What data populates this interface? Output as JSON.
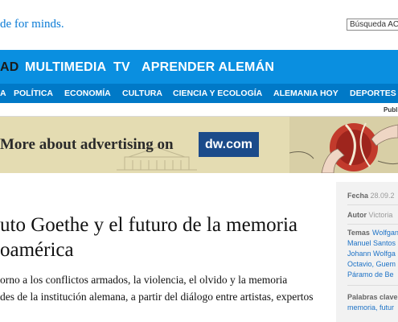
{
  "header": {
    "tagline": "de for minds.",
    "search_value": "Búsqueda ACT"
  },
  "main_nav": {
    "items": [
      {
        "label": "AD",
        "active": true
      },
      {
        "label": "MULTIMEDIA"
      },
      {
        "label": "TV"
      },
      {
        "label": "APRENDER ALEMÁN"
      }
    ]
  },
  "sub_nav": {
    "items": [
      {
        "label": "A"
      },
      {
        "label": "POLÍTICA"
      },
      {
        "label": "ECONOMÍA"
      },
      {
        "label": "CULTURA"
      },
      {
        "label": "CIENCIA Y ECOLOGÍA"
      },
      {
        "label": "ALEMANIA HOY"
      },
      {
        "label": "DEPORTES"
      }
    ]
  },
  "utility": {
    "label": "Publi"
  },
  "banner": {
    "text": "More about advertising on",
    "domain": "dw.com"
  },
  "article": {
    "headline_line1": "uto Goethe y el futuro de la memoria",
    "headline_line2": "oamérica",
    "lead_line1": "orno a los conflictos armados, la violencia, el olvido y la memoria",
    "lead_line2": "des de la institución alemana, a partir del diálogo entre artistas, expertos"
  },
  "meta": {
    "date_label": "Fecha",
    "date_value": "28.09.2",
    "author_label": "Autor",
    "author_value": "Victoria",
    "topics_label": "Temas",
    "topics": [
      "Wolfgan",
      "Manuel Santos",
      "Johann Wolfga",
      "Octavio, Guem",
      "Páramo de Be"
    ],
    "keywords_label": "Palabras clave",
    "keywords": [
      "memoria, futur"
    ]
  },
  "colors": {
    "nav_primary": "#0a8fe0",
    "nav_secondary": "#0079c7",
    "link": "#1d72c6",
    "banner_bg": "#e4dcb2",
    "banner_domain_bg": "#1b4b8a"
  }
}
